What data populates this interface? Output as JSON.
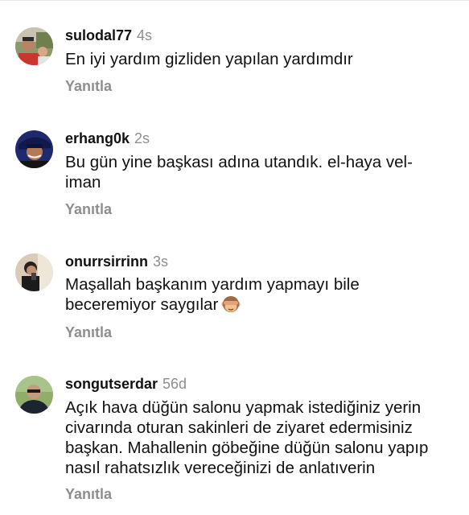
{
  "reply_label": "Yanıtla",
  "comments": [
    {
      "username": "sulodal77",
      "time": "4s",
      "lines": [
        "En iyi yardım gizliden yapılan yardımdır"
      ]
    },
    {
      "username": "erhang0k",
      "time": "2s",
      "lines": [
        "Bu gün yine başkası adına  utandık.  el-haya vel-",
        "iman"
      ]
    },
    {
      "username": "onurrsirrinn",
      "time": "3s",
      "lines": [
        "Maşallah başkanım yardım yapmayı bile",
        "beceremiyor saygılar"
      ],
      "emoji": "see-no-evil-monkey"
    },
    {
      "username": "songutserdar",
      "time": "56d",
      "lines": [
        "Açık hava düğün salonu yapmak istediğiniz yerin",
        "civarında oturan sakinleri de ziyaret edermisiniz",
        "başkan.  Mahallenin göbeğine düğün salonu yapıp",
        "nasıl rahatsızlık vereceğinizi de anlatıverin"
      ]
    }
  ]
}
